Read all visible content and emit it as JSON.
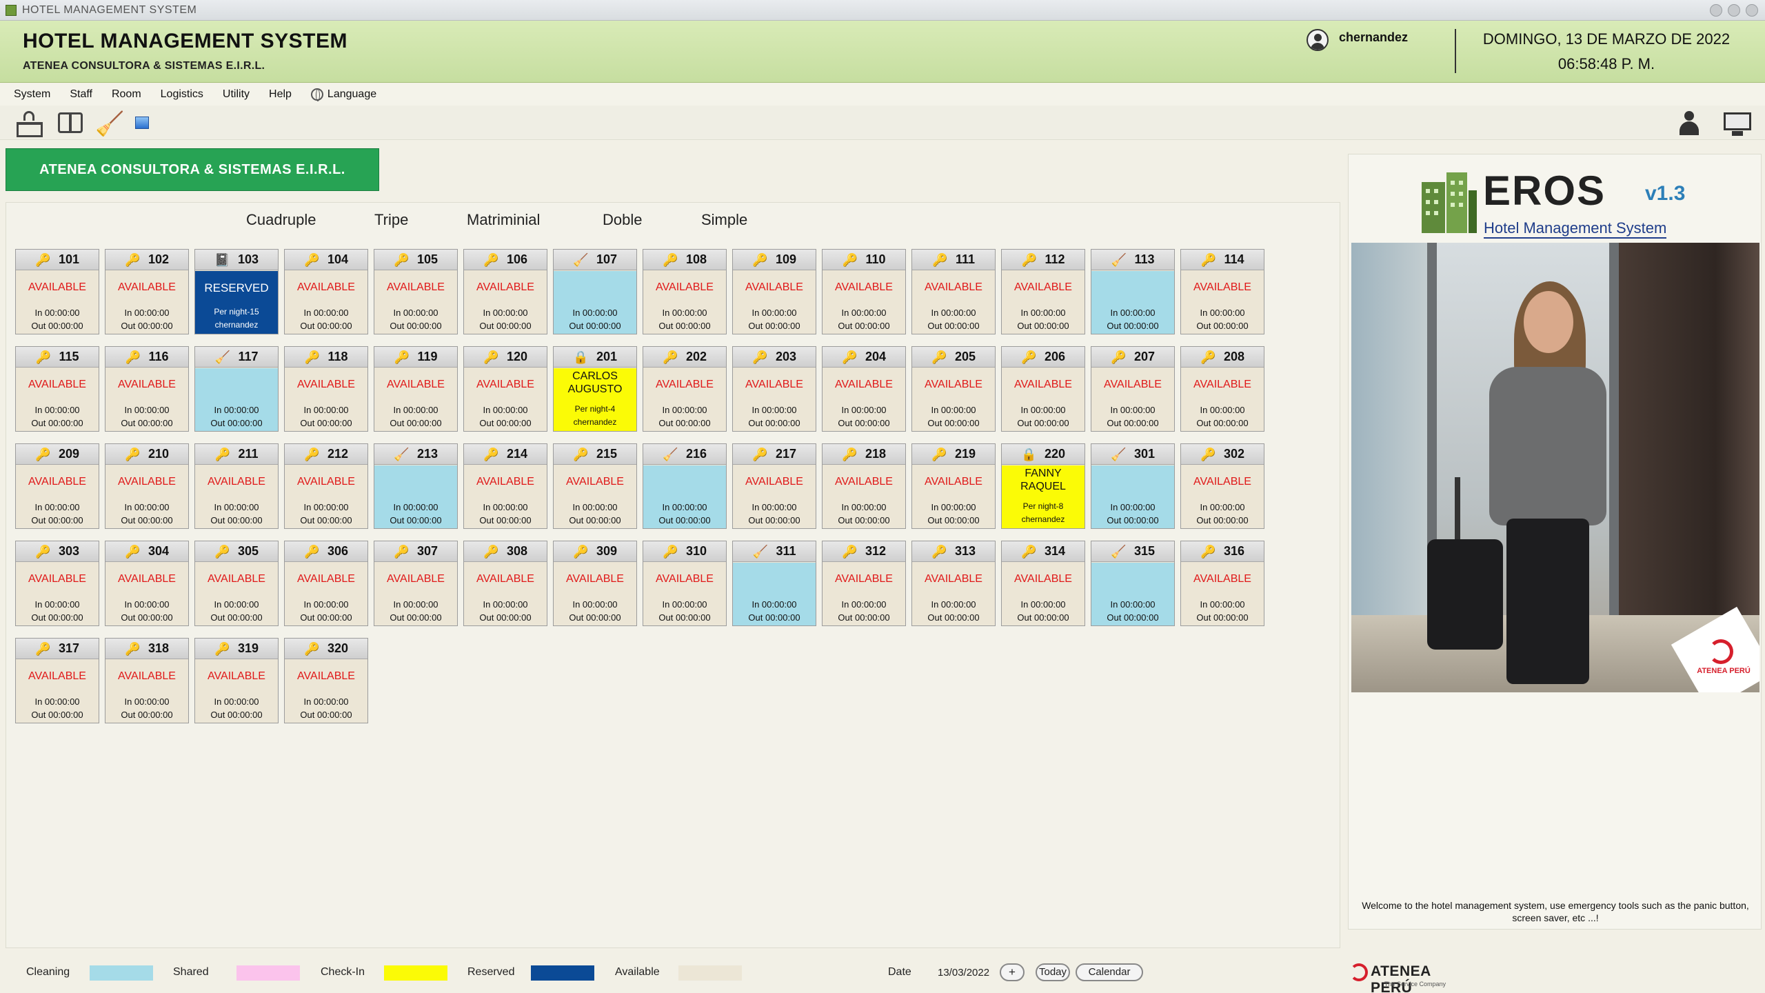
{
  "window": {
    "title": "HOTEL MANAGEMENT SYSTEM"
  },
  "header": {
    "app_title": "HOTEL MANAGEMENT SYSTEM",
    "company": "ATENEA CONSULTORA & SISTEMAS E.I.R.L.",
    "username": "chernandez",
    "date": "DOMINGO, 13 DE MARZO DE 2022",
    "time": "06:58:48 P. M."
  },
  "menu": [
    "System",
    "Staff",
    "Room",
    "Logistics",
    "Utility",
    "Help",
    "Language"
  ],
  "company_button": "ATENEA CONSULTORA & SISTEMAS E.I.R.L.",
  "filters": [
    "Cuadruple",
    "Tripe",
    "Matriminial",
    "Doble",
    "Simple"
  ],
  "rooms": [
    {
      "num": "101",
      "state": "available",
      "status": "AVAILABLE",
      "in": "In 00:00:00",
      "out": "Out 00:00:00"
    },
    {
      "num": "102",
      "state": "available",
      "status": "AVAILABLE",
      "in": "In 00:00:00",
      "out": "Out 00:00:00"
    },
    {
      "num": "103",
      "state": "reserved",
      "status": "RESERVED",
      "in": "Per night-15",
      "out": "chernandez"
    },
    {
      "num": "104",
      "state": "available",
      "status": "AVAILABLE",
      "in": "In 00:00:00",
      "out": "Out 00:00:00"
    },
    {
      "num": "105",
      "state": "available",
      "status": "AVAILABLE",
      "in": "In 00:00:00",
      "out": "Out 00:00:00"
    },
    {
      "num": "106",
      "state": "available",
      "status": "AVAILABLE",
      "in": "In 00:00:00",
      "out": "Out 00:00:00"
    },
    {
      "num": "107",
      "state": "cleaning",
      "status": "",
      "in": "In 00:00:00",
      "out": "Out 00:00:00"
    },
    {
      "num": "108",
      "state": "available",
      "status": "AVAILABLE",
      "in": "In 00:00:00",
      "out": "Out 00:00:00"
    },
    {
      "num": "109",
      "state": "available",
      "status": "AVAILABLE",
      "in": "In 00:00:00",
      "out": "Out 00:00:00"
    },
    {
      "num": "110",
      "state": "available",
      "status": "AVAILABLE",
      "in": "In 00:00:00",
      "out": "Out 00:00:00"
    },
    {
      "num": "111",
      "state": "available",
      "status": "AVAILABLE",
      "in": "In 00:00:00",
      "out": "Out 00:00:00"
    },
    {
      "num": "112",
      "state": "available",
      "status": "AVAILABLE",
      "in": "In 00:00:00",
      "out": "Out 00:00:00"
    },
    {
      "num": "113",
      "state": "cleaning",
      "status": "",
      "in": "In 00:00:00",
      "out": "Out 00:00:00"
    },
    {
      "num": "114",
      "state": "available",
      "status": "AVAILABLE",
      "in": "In 00:00:00",
      "out": "Out 00:00:00"
    },
    {
      "num": "115",
      "state": "available",
      "status": "AVAILABLE",
      "in": "In 00:00:00",
      "out": "Out 00:00:00"
    },
    {
      "num": "116",
      "state": "available",
      "status": "AVAILABLE",
      "in": "In 00:00:00",
      "out": "Out 00:00:00"
    },
    {
      "num": "117",
      "state": "cleaning",
      "status": "",
      "in": "In 00:00:00",
      "out": "Out 00:00:00"
    },
    {
      "num": "118",
      "state": "available",
      "status": "AVAILABLE",
      "in": "In 00:00:00",
      "out": "Out 00:00:00"
    },
    {
      "num": "119",
      "state": "available",
      "status": "AVAILABLE",
      "in": "In 00:00:00",
      "out": "Out 00:00:00"
    },
    {
      "num": "120",
      "state": "available",
      "status": "AVAILABLE",
      "in": "In 00:00:00",
      "out": "Out 00:00:00"
    },
    {
      "num": "201",
      "state": "checkin",
      "status": "CARLOS AUGUSTO",
      "in": "Per night-4",
      "out": "chernandez"
    },
    {
      "num": "202",
      "state": "available",
      "status": "AVAILABLE",
      "in": "In 00:00:00",
      "out": "Out 00:00:00"
    },
    {
      "num": "203",
      "state": "available",
      "status": "AVAILABLE",
      "in": "In 00:00:00",
      "out": "Out 00:00:00"
    },
    {
      "num": "204",
      "state": "available",
      "status": "AVAILABLE",
      "in": "In 00:00:00",
      "out": "Out 00:00:00"
    },
    {
      "num": "205",
      "state": "available",
      "status": "AVAILABLE",
      "in": "In 00:00:00",
      "out": "Out 00:00:00"
    },
    {
      "num": "206",
      "state": "available",
      "status": "AVAILABLE",
      "in": "In 00:00:00",
      "out": "Out 00:00:00"
    },
    {
      "num": "207",
      "state": "available",
      "status": "AVAILABLE",
      "in": "In 00:00:00",
      "out": "Out 00:00:00"
    },
    {
      "num": "208",
      "state": "available",
      "status": "AVAILABLE",
      "in": "In 00:00:00",
      "out": "Out 00:00:00"
    },
    {
      "num": "209",
      "state": "available",
      "status": "AVAILABLE",
      "in": "In 00:00:00",
      "out": "Out 00:00:00"
    },
    {
      "num": "210",
      "state": "available",
      "status": "AVAILABLE",
      "in": "In 00:00:00",
      "out": "Out 00:00:00"
    },
    {
      "num": "211",
      "state": "available",
      "status": "AVAILABLE",
      "in": "In 00:00:00",
      "out": "Out 00:00:00"
    },
    {
      "num": "212",
      "state": "available",
      "status": "AVAILABLE",
      "in": "In 00:00:00",
      "out": "Out 00:00:00"
    },
    {
      "num": "213",
      "state": "cleaning",
      "status": "",
      "in": "In 00:00:00",
      "out": "Out 00:00:00"
    },
    {
      "num": "214",
      "state": "available",
      "status": "AVAILABLE",
      "in": "In 00:00:00",
      "out": "Out 00:00:00"
    },
    {
      "num": "215",
      "state": "available",
      "status": "AVAILABLE",
      "in": "In 00:00:00",
      "out": "Out 00:00:00"
    },
    {
      "num": "216",
      "state": "cleaning",
      "status": "",
      "in": "In 00:00:00",
      "out": "Out 00:00:00"
    },
    {
      "num": "217",
      "state": "available",
      "status": "AVAILABLE",
      "in": "In 00:00:00",
      "out": "Out 00:00:00"
    },
    {
      "num": "218",
      "state": "available",
      "status": "AVAILABLE",
      "in": "In 00:00:00",
      "out": "Out 00:00:00"
    },
    {
      "num": "219",
      "state": "available",
      "status": "AVAILABLE",
      "in": "In 00:00:00",
      "out": "Out 00:00:00"
    },
    {
      "num": "220",
      "state": "checkin",
      "status": "FANNY RAQUEL",
      "in": "Per night-8",
      "out": "chernandez"
    },
    {
      "num": "301",
      "state": "cleaning",
      "status": "",
      "in": "In 00:00:00",
      "out": "Out 00:00:00"
    },
    {
      "num": "302",
      "state": "available",
      "status": "AVAILABLE",
      "in": "In 00:00:00",
      "out": "Out 00:00:00"
    },
    {
      "num": "303",
      "state": "available",
      "status": "AVAILABLE",
      "in": "In 00:00:00",
      "out": "Out 00:00:00"
    },
    {
      "num": "304",
      "state": "available",
      "status": "AVAILABLE",
      "in": "In 00:00:00",
      "out": "Out 00:00:00"
    },
    {
      "num": "305",
      "state": "available",
      "status": "AVAILABLE",
      "in": "In 00:00:00",
      "out": "Out 00:00:00"
    },
    {
      "num": "306",
      "state": "available",
      "status": "AVAILABLE",
      "in": "In 00:00:00",
      "out": "Out 00:00:00"
    },
    {
      "num": "307",
      "state": "available",
      "status": "AVAILABLE",
      "in": "In 00:00:00",
      "out": "Out 00:00:00"
    },
    {
      "num": "308",
      "state": "available",
      "status": "AVAILABLE",
      "in": "In 00:00:00",
      "out": "Out 00:00:00"
    },
    {
      "num": "309",
      "state": "available",
      "status": "AVAILABLE",
      "in": "In 00:00:00",
      "out": "Out 00:00:00"
    },
    {
      "num": "310",
      "state": "available",
      "status": "AVAILABLE",
      "in": "In 00:00:00",
      "out": "Out 00:00:00"
    },
    {
      "num": "311",
      "state": "cleaning",
      "status": "",
      "in": "In 00:00:00",
      "out": "Out 00:00:00"
    },
    {
      "num": "312",
      "state": "available",
      "status": "AVAILABLE",
      "in": "In 00:00:00",
      "out": "Out 00:00:00"
    },
    {
      "num": "313",
      "state": "available",
      "status": "AVAILABLE",
      "in": "In 00:00:00",
      "out": "Out 00:00:00"
    },
    {
      "num": "314",
      "state": "available",
      "status": "AVAILABLE",
      "in": "In 00:00:00",
      "out": "Out 00:00:00"
    },
    {
      "num": "315",
      "state": "cleaning",
      "status": "",
      "in": "In 00:00:00",
      "out": "Out 00:00:00"
    },
    {
      "num": "316",
      "state": "available",
      "status": "AVAILABLE",
      "in": "In 00:00:00",
      "out": "Out 00:00:00"
    },
    {
      "num": "317",
      "state": "available",
      "status": "AVAILABLE",
      "in": "In 00:00:00",
      "out": "Out 00:00:00"
    },
    {
      "num": "318",
      "state": "available",
      "status": "AVAILABLE",
      "in": "In 00:00:00",
      "out": "Out 00:00:00"
    },
    {
      "num": "319",
      "state": "available",
      "status": "AVAILABLE",
      "in": "In 00:00:00",
      "out": "Out 00:00:00"
    },
    {
      "num": "320",
      "state": "available",
      "status": "AVAILABLE",
      "in": "In 00:00:00",
      "out": "Out 00:00:00"
    }
  ],
  "logo": {
    "brand": "EROS",
    "version": "v1.3",
    "tagline": "Hotel Management System"
  },
  "photo_badge": "ATENEA PERÚ",
  "welcome": "Welcome to the hotel management system, use emergency tools such as the panic button, screen saver, etc ...!",
  "legend": [
    {
      "label": "Cleaning",
      "color": "#a5dbe8"
    },
    {
      "label": "Shared",
      "color": "#fbc3ec"
    },
    {
      "label": "Check-In",
      "color": "#fbfb06"
    },
    {
      "label": "Reserved",
      "color": "#0b4a96"
    },
    {
      "label": "Available",
      "color": "#ece6d6"
    }
  ],
  "date_bar": {
    "label": "Date",
    "value": "13/03/2022",
    "plus": "+",
    "today": "Today",
    "calendar": "Calendar"
  },
  "footer": {
    "brand": "ATENEA PERÚ",
    "sub": "The Service Company"
  }
}
